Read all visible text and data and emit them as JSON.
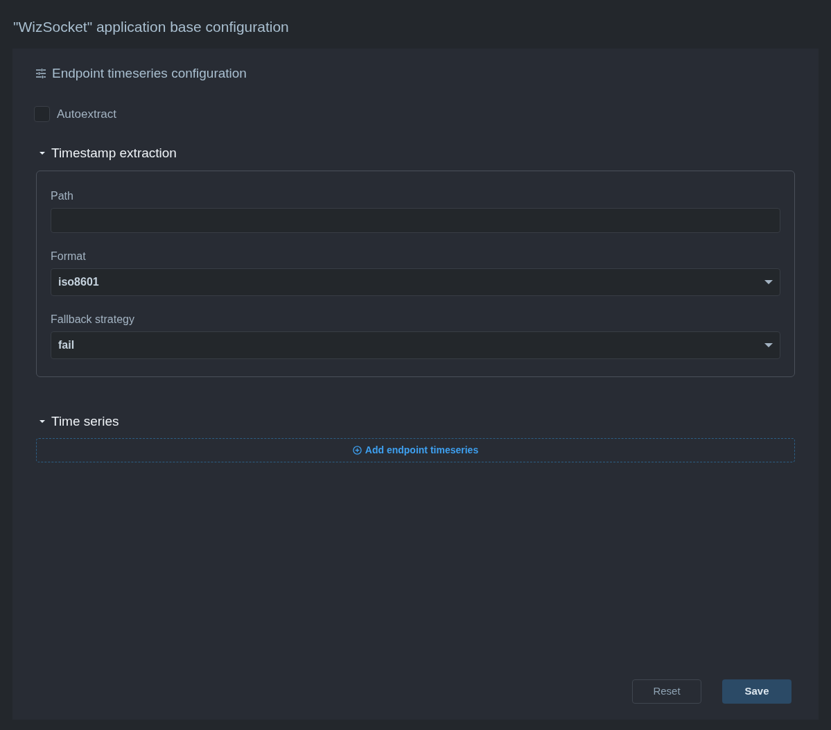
{
  "page_title": "\"WizSocket\" application base configuration",
  "panel": {
    "title": "Endpoint timeseries configuration",
    "autoextract": {
      "label": "Autoextract",
      "checked": false
    },
    "timestamp_section": {
      "title": "Timestamp extraction",
      "expanded": true,
      "fields": [
        {
          "kind": "text",
          "label": "Path"
        },
        {
          "kind": "select",
          "label": "Format",
          "value": "iso8601"
        },
        {
          "kind": "select",
          "label": "Fallback strategy",
          "value": "fail"
        }
      ]
    },
    "timeseries_section": {
      "title": "Time series",
      "expanded": true,
      "add_button": "Add endpoint timeseries"
    },
    "buttons": [
      {
        "kind": "secondary",
        "label": "Reset"
      },
      {
        "kind": "primary",
        "label": "Save"
      }
    ]
  }
}
